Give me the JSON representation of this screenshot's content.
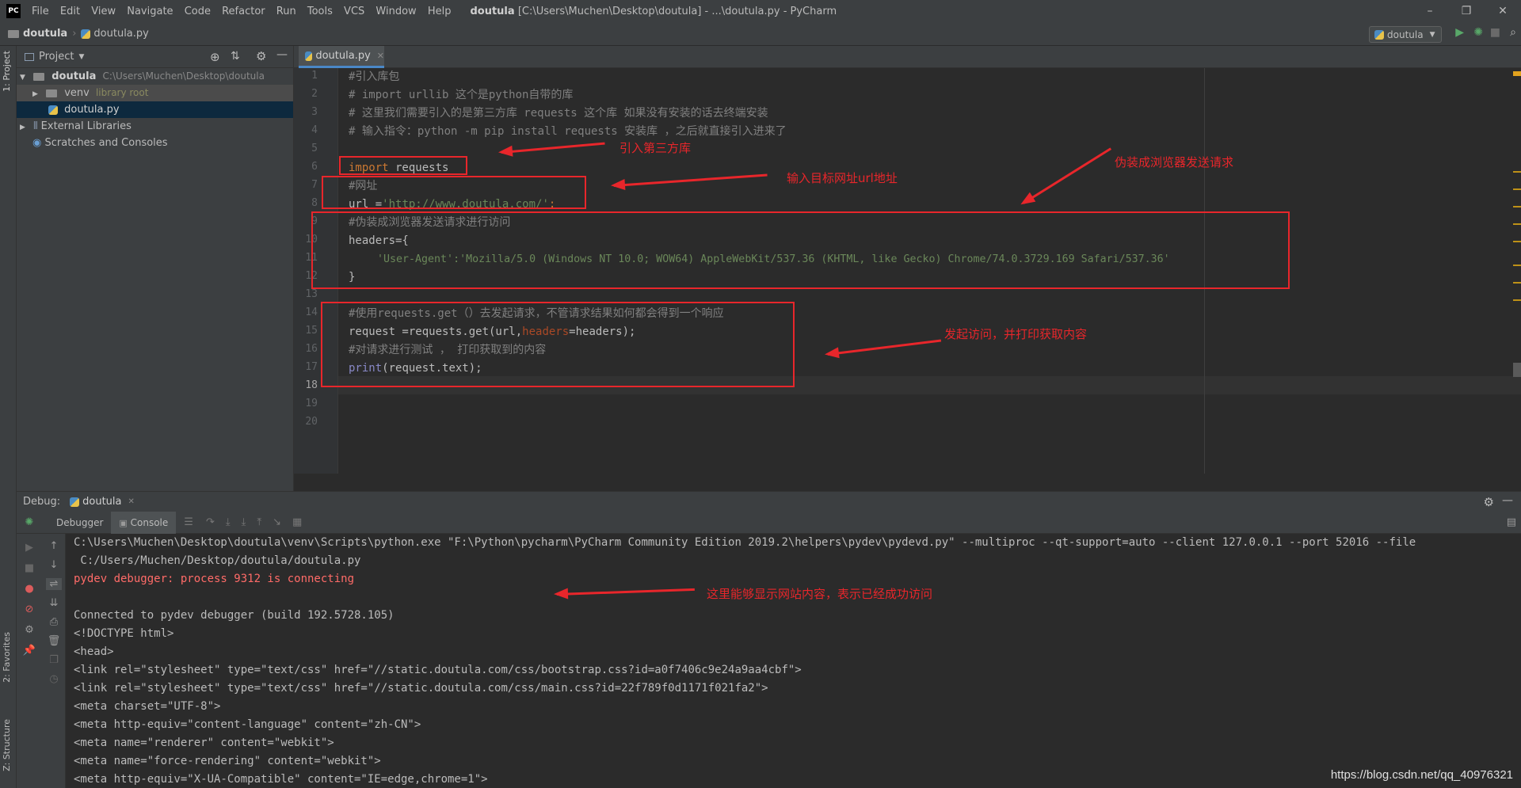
{
  "titlebar": {
    "logo": "PC",
    "menu": [
      "File",
      "Edit",
      "View",
      "Navigate",
      "Code",
      "Refactor",
      "Run",
      "Tools",
      "VCS",
      "Window",
      "Help"
    ],
    "project": "doutula",
    "title": "[C:\\Users\\Muchen\\Desktop\\doutula] - ...\\doutula.py - PyCharm",
    "minimize": "–",
    "restore": "❐",
    "close": "✕"
  },
  "navbar": {
    "crumb_project": "doutula",
    "crumb_file": "doutula.py",
    "run_config": "doutula"
  },
  "side": {
    "project_tab": "1: Project",
    "favorites_tab": "2: Favorites",
    "structure_tab": "Z: Structure"
  },
  "project_panel": {
    "title": "Project",
    "root_name": "doutula",
    "root_path": "C:\\Users\\Muchen\\Desktop\\doutula",
    "venv": "venv",
    "venv_hint": "library root",
    "file": "doutula.py",
    "external": "External Libraries",
    "scratches": "Scratches and Consoles"
  },
  "editor": {
    "tab": "doutula.py",
    "line_numbers": [
      "1",
      "2",
      "3",
      "4",
      "5",
      "6",
      "7",
      "8",
      "9",
      "10",
      "11",
      "12",
      "13",
      "14",
      "15",
      "16",
      "17",
      "18",
      "19",
      "20"
    ],
    "lines": {
      "l1": "#引入库包",
      "l2": "# import urllib 这个是python自带的库",
      "l3": "# 这里我们需要引入的是第三方库 requests 这个库 如果没有安装的话去终端安装",
      "l4": "# 输入指令：python -m pip install requests 安装库 ，之后就直接引入进来了",
      "l6_kw": "import",
      "l6_rest": " requests",
      "l7": "#网址",
      "l8_a": "url =",
      "l8_str": "'http://www.doutula.com/'",
      "l8_b": ";",
      "l9": "#伪装成浏览器发送请求进行访问",
      "l10": "headers={",
      "l11": "'User-Agent':'Mozilla/5.0 (Windows NT 10.0; WOW64) AppleWebKit/537.36 (KHTML, like Gecko) Chrome/74.0.3729.169 Safari/537.36'",
      "l12": "}",
      "l14": "#使用requests.get（）去发起请求，不管请求结果如何都会得到一个响应",
      "l15_a": "request =requests.get(url,",
      "l15_prm": "headers",
      "l15_b": "=headers);",
      "l16": "#对请求进行测试 ， 打印获取到的内容",
      "l17_fn": "print",
      "l17_rest": "(request.text);"
    }
  },
  "annotations": {
    "a1": "引入第三方库",
    "a2": "输入目标网址url地址",
    "a3": "伪装成浏览器发送请求",
    "a4": "发起访问，并打印获取内容",
    "a5": "这里能够显示网站内容，表示已经成功访问"
  },
  "debug": {
    "label": "Debug:",
    "session": "doutula",
    "tab_debugger": "Debugger",
    "tab_console": "Console",
    "output": [
      "C:\\Users\\Muchen\\Desktop\\doutula\\venv\\Scripts\\python.exe \"F:\\Python\\pycharm\\PyCharm Community Edition 2019.2\\helpers\\pydev\\pydevd.py\" --multiproc --qt-support=auto --client 127.0.0.1 --port 52016 --file",
      " C:/Users/Muchen/Desktop/doutula/doutula.py",
      "pydev debugger: process 9312 is connecting",
      "",
      "Connected to pydev debugger (build 192.5728.105)",
      "<!DOCTYPE html>",
      "<head>",
      "<link rel=\"stylesheet\" type=\"text/css\" href=\"//static.doutula.com/css/bootstrap.css?id=a0f7406c9e24a9aa4cbf\">",
      "<link rel=\"stylesheet\" type=\"text/css\" href=\"//static.doutula.com/css/main.css?id=22f789f0d1171f021fa2\">",
      "<meta charset=\"UTF-8\">",
      "<meta http-equiv=\"content-language\" content=\"zh-CN\">",
      "<meta name=\"renderer\" content=\"webkit\">",
      "<meta name=\"force-rendering\" content=\"webkit\">",
      "<meta http-equiv=\"X-UA-Compatible\" content=\"IE=edge,chrome=1\">"
    ]
  },
  "watermark": "https://blog.csdn.net/qq_40976321",
  "colors": {
    "annotation": "#e8262b",
    "keyword": "#cc7832",
    "string": "#6a8759",
    "comment": "#808080",
    "error": "#ff6b68"
  }
}
